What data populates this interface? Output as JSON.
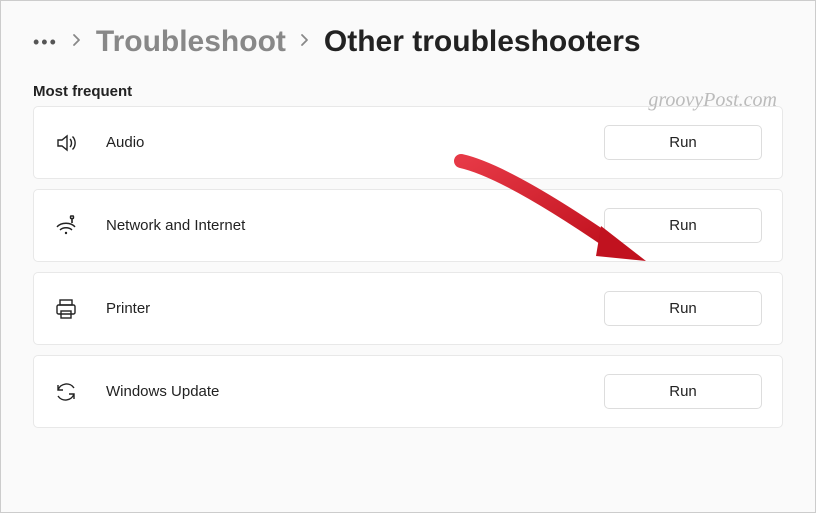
{
  "breadcrumb": {
    "dots": "•••",
    "parent": "Troubleshoot",
    "current": "Other troubleshooters"
  },
  "section_title": "Most frequent",
  "watermark": "groovyPost.com",
  "items": [
    {
      "label": "Audio",
      "button": "Run"
    },
    {
      "label": "Network and Internet",
      "button": "Run"
    },
    {
      "label": "Printer",
      "button": "Run"
    },
    {
      "label": "Windows Update",
      "button": "Run"
    }
  ]
}
